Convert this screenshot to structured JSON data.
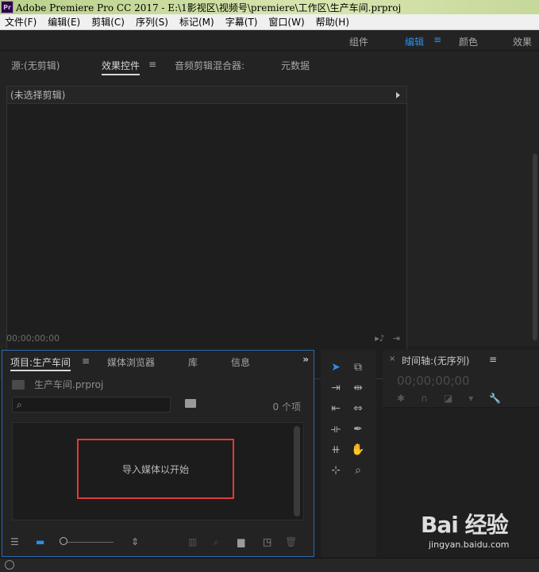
{
  "window": {
    "title": "Adobe Premiere Pro CC 2017 - E:\\1影视区\\视频号\\premiere\\工作区\\生产车间.prproj",
    "logo": "Pr"
  },
  "menubar": {
    "items": [
      "文件(F)",
      "编辑(E)",
      "剪辑(C)",
      "序列(S)",
      "标记(M)",
      "字幕(T)",
      "窗口(W)",
      "帮助(H)"
    ]
  },
  "workspaces": {
    "items": [
      "组件",
      "编辑",
      "颜色",
      "效果"
    ],
    "active": "编辑",
    "accent_color": "#2d8ceb"
  },
  "source_panel": {
    "tabs": [
      "源:(无剪辑)",
      "效果控件",
      "音频剪辑混合器:",
      "元数据"
    ],
    "active_tab": "效果控件",
    "no_clip_label": "(未选择剪辑)",
    "timecode": "00;00;00;00"
  },
  "project_panel": {
    "tabs": [
      "项目:生产车间",
      "媒体浏览器",
      "库",
      "信息"
    ],
    "active_tab": "项目:生产车间",
    "project_file": "生产车间.prproj",
    "search_placeholder": "",
    "item_count": "0 个项",
    "import_prompt": "导入媒体以开始",
    "highlight_color": "#e03a3a"
  },
  "tools": {
    "items": [
      "selection-tool",
      "track-select-tool",
      "ripple-edit-tool",
      "rolling-edit-tool",
      "rate-stretch-tool",
      "razor-tool",
      "slip-tool",
      "slide-tool",
      "pen-tool",
      "hand-tool",
      "zoom-tool",
      "lasso-tool"
    ],
    "active": "selection-tool"
  },
  "timeline_panel": {
    "title": "时间轴:(无序列)",
    "timecode": "00;00;00;00"
  },
  "watermark": {
    "logo": "Bai 经验",
    "url": "jingyan.baidu.com"
  }
}
